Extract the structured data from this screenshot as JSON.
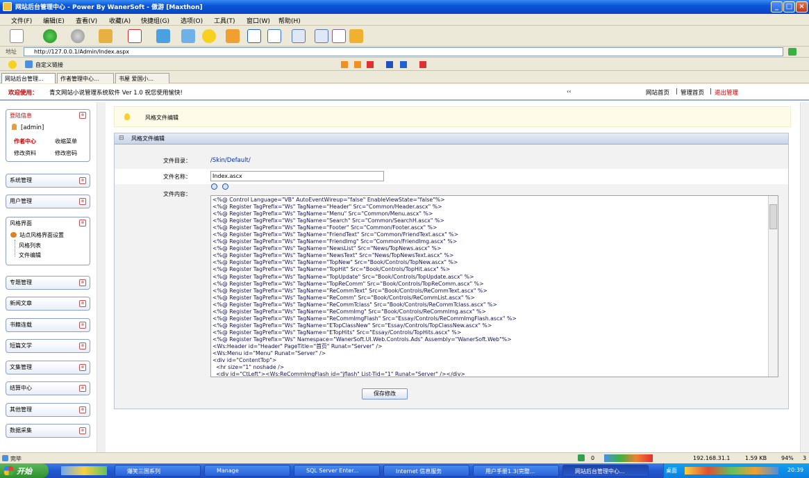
{
  "window": {
    "title": "网站后台管理中心 - Power By WanerSoft - 傲游 [Maxthon]",
    "btn_min": "_",
    "btn_max": "□",
    "btn_close": "×"
  },
  "menubar": [
    "文件(F)",
    "编辑(E)",
    "查看(V)",
    "收藏(A)",
    "快捷组(G)",
    "选项(O)",
    "工具(T)",
    "窗口(W)",
    "帮助(H)"
  ],
  "address": {
    "label": "地址",
    "url": "http://127.0.0.1/Admin/Index.aspx"
  },
  "favbar": {
    "label": "自定义链接"
  },
  "tabs": [
    "网站后台管理...",
    "作者管理中心...",
    "书屋 爱国小..."
  ],
  "header": {
    "welcome": "欢迎使用：",
    "product": "青文网站小说管理系统软件  Ver 1.0   祝您使用愉快!",
    "collapse": "‹‹",
    "link_home": "网站首页",
    "sep1": "|",
    "link_admin": "管理首页",
    "sep2": "|",
    "link_logout": "退出管理"
  },
  "sidebar": {
    "login": {
      "title": "登陆信息",
      "user": "[admin]",
      "author_center": "作者中心",
      "fav_menu": "收缩菜单",
      "edit_profile": "修改资料",
      "edit_password": "修改密码"
    },
    "items_top": [
      "系统管理",
      "用户管理"
    ],
    "style": {
      "title": "风格界面",
      "sub": "站点风格界面设置",
      "list": "风格列表",
      "edit": "文件编辑"
    },
    "items_bottom": [
      "专题管理",
      "新闻文章",
      "书籍连载",
      "短篇文学",
      "文集管理",
      "结算中心",
      "其他管理",
      "数据采集"
    ],
    "arrow": "⊗"
  },
  "main": {
    "tip": "风格文件编辑",
    "panel_title": "风格文件编辑",
    "panel_toggle": "⊟",
    "dir_label": "文件目录：",
    "dir_value": "/Skin/Default/",
    "name_label": "文件名称：",
    "name_value": "Index.ascx",
    "content_label": "文件内容：",
    "code": "<%@ Control Language=\"VB\" AutoEventWireup=\"false\" EnableViewState=\"false\"%>\n<%@ Register TagPrefix=\"Ws\" TagName=\"Header\" Src=\"Common/Header.ascx\" %>\n<%@ Register TagPrefix=\"Ws\" TagName=\"Menu\" Src=\"Common/Menu.ascx\" %>\n<%@ Register TagPrefix=\"Ws\" TagName=\"Search\" Src=\"Common/SearchH.ascx\" %>\n<%@ Register TagPrefix=\"Ws\" TagName=\"Footer\" Src=\"Common/Footer.ascx\" %>\n<%@ Register TagPrefix=\"Ws\" TagName=\"FriendText\" Src=\"Common/FriendText.ascx\" %>\n<%@ Register TagPrefix=\"Ws\" TagName=\"FriendImg\" Src=\"Common/FriendImg.ascx\" %>\n<%@ Register TagPrefix=\"Ws\" TagName=\"NewsList\" Src=\"News/TopNews.ascx\" %>\n<%@ Register TagPrefix=\"Ws\" TagName=\"NewsText\" Src=\"News/TopNewsText.ascx\" %>\n<%@ Register TagPrefix=\"Ws\" TagName=\"TopNew\" Src=\"Book/Controls/TopNew.ascx\" %>\n<%@ Register TagPrefix=\"Ws\" TagName=\"TopHit\" Src=\"Book/Controls/TopHit.ascx\" %>\n<%@ Register TagPrefix=\"Ws\" TagName=\"TopUpdate\" Src=\"Book/Controls/TopUpdate.ascx\" %>\n<%@ Register TagPrefix=\"Ws\" TagName=\"TopReComm\" Src=\"Book/Controls/TopReComm.ascx\" %>\n<%@ Register TagPrefix=\"Ws\" TagName=\"ReCommText\" Src=\"Book/Controls/ReCommText.ascx\" %>\n<%@ Register TagPrefix=\"Ws\" TagName=\"ReComm\" Src=\"Book/Controls/ReCommList.ascx\" %>\n<%@ Register TagPrefix=\"Ws\" TagName=\"ReCommTclass\" Src=\"Book/Controls/ReCommTclass.ascx\" %>\n<%@ Register TagPrefix=\"Ws\" TagName=\"ReCommImg\" Src=\"Book/Controls/ReCommImg.ascx\" %>\n<%@ Register TagPrefix=\"Ws\" TagName=\"ReCommImgFlash\" Src=\"Essay/Controls/ReCommImgFlash.ascx\" %>\n<%@ Register TagPrefix=\"Ws\" TagName=\"ETopClassNew\" Src=\"Essay/Controls/TopClassNew.ascx\" %>\n<%@ Register TagPrefix=\"Ws\" TagName=\"ETopHits\" Src=\"Essay/Controls/TopHits.ascx\" %>\n<%@ Register TagPrefix=\"Ws\" Namespace=\"WanerSoft.UI.Web.Controls.Ads\" Assembly=\"WanerSoft.Web\"%>\n<Ws:Header id=\"Header\" PageTitle=\"首页\" Runat=\"Server\" />\n<Ws:Menu id=\"Menu\" Runat=\"Server\" />\n<div id=\"ContentTop\">\n  <hr size=\"1\" noshade />\n  <div id=\"CtLeft\"><Ws:ReCommImgFlash id=\"jflash\" List-Tid=\"1\" Runat=\"Server\" /></div>",
    "save_button": "保存修改"
  },
  "status": {
    "text": "完毕",
    "zoom": "0",
    "ip": "192.168.31.1",
    "size": "1.59 KB",
    "percent": "94%",
    "num": "3"
  },
  "taskbar": {
    "start": "开始",
    "tasks": [
      "爆笑三国系列",
      "Manage",
      "SQL Server Enter...",
      "Internet 信息服务",
      "用户手册1.3(完整...",
      "网站后台管理中心..."
    ],
    "tray_label": "桌面",
    "clock": "20:39"
  },
  "colors": {
    "accent": "#0a55d8",
    "brand_red": "#c00000"
  }
}
